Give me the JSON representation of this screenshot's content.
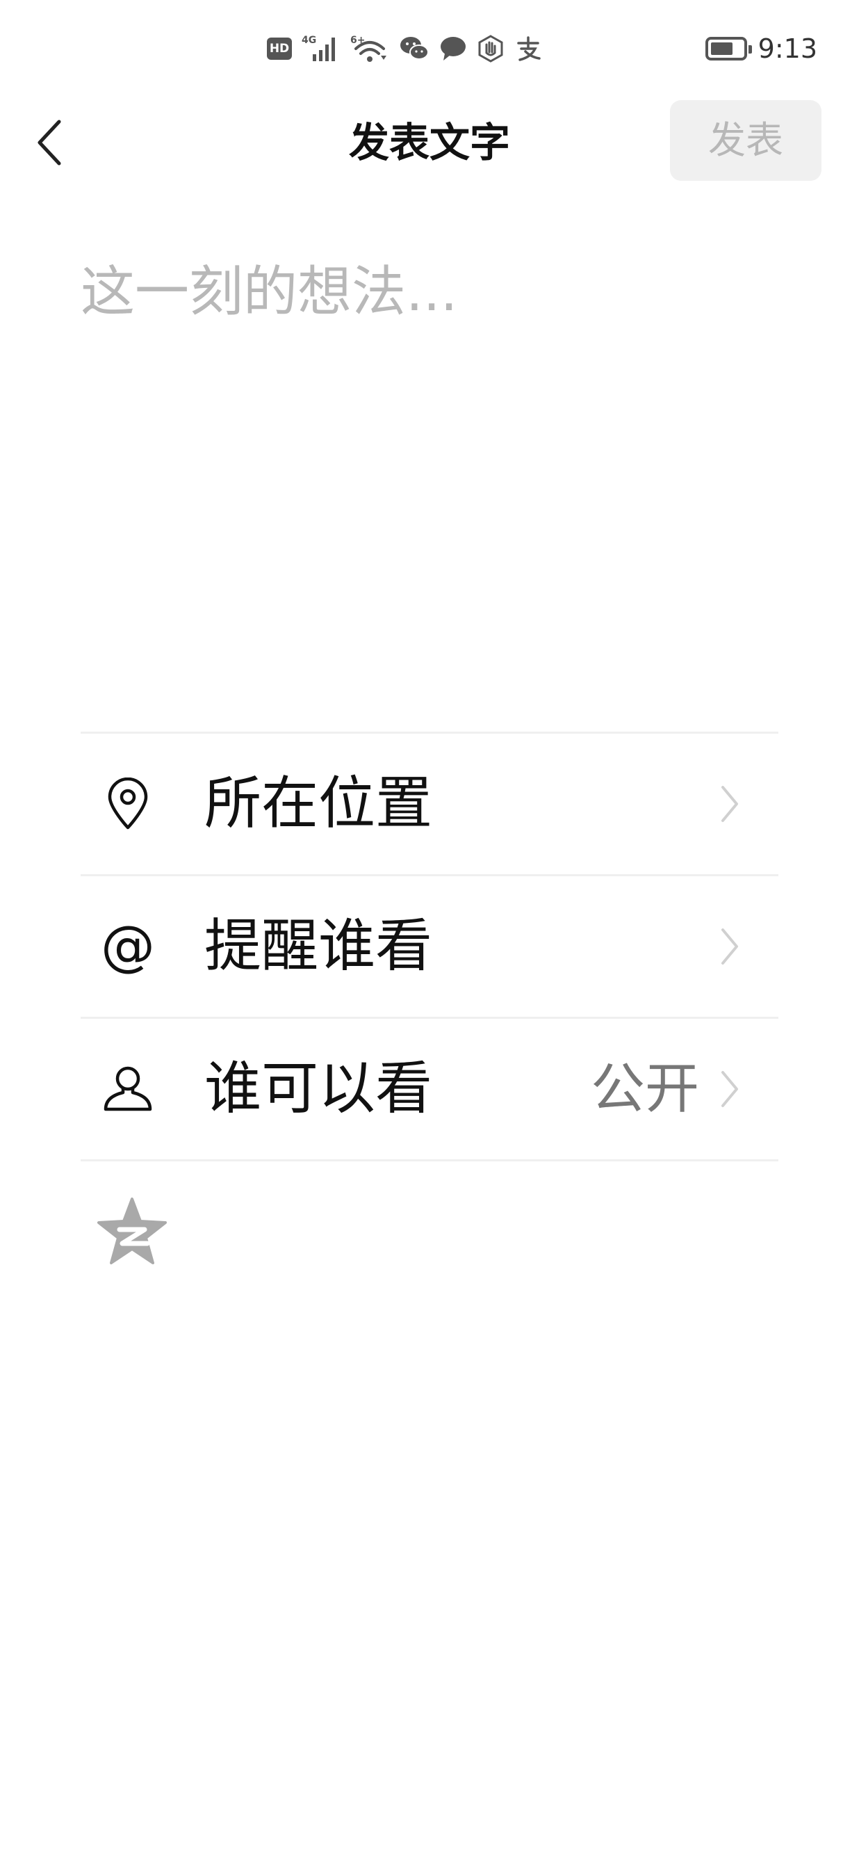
{
  "status_bar": {
    "hd_label": "HD",
    "network_label": "4G",
    "wifi_label": "6+",
    "icons": [
      "hd-icon",
      "signal-4g-icon",
      "wifi-6-icon",
      "wechat-icon",
      "message-icon",
      "hand-icon",
      "alipay-icon"
    ],
    "battery_level": 0.7,
    "time": "9:13"
  },
  "header": {
    "title": "发表文字",
    "publish_label": "发表",
    "back_icon": "chevron-left-icon"
  },
  "compose": {
    "placeholder": "这一刻的想法...",
    "value": ""
  },
  "options": {
    "location": {
      "label": "所在位置",
      "icon": "location-pin-icon"
    },
    "mention": {
      "label": "提醒谁看",
      "icon_glyph": "@"
    },
    "visibility": {
      "label": "谁可以看",
      "value": "公开",
      "icon": "person-icon"
    }
  },
  "share": {
    "icon": "qzone-icon"
  },
  "colors": {
    "background": "#ffffff",
    "text": "#111111",
    "placeholder": "#b8b8b8",
    "publish_disabled_bg": "#f0f0f0",
    "publish_disabled_text": "#b7b7b7",
    "divider": "#efefef",
    "chevron": "#d0d0d0",
    "qzone_gray": "#a9a9a9"
  }
}
